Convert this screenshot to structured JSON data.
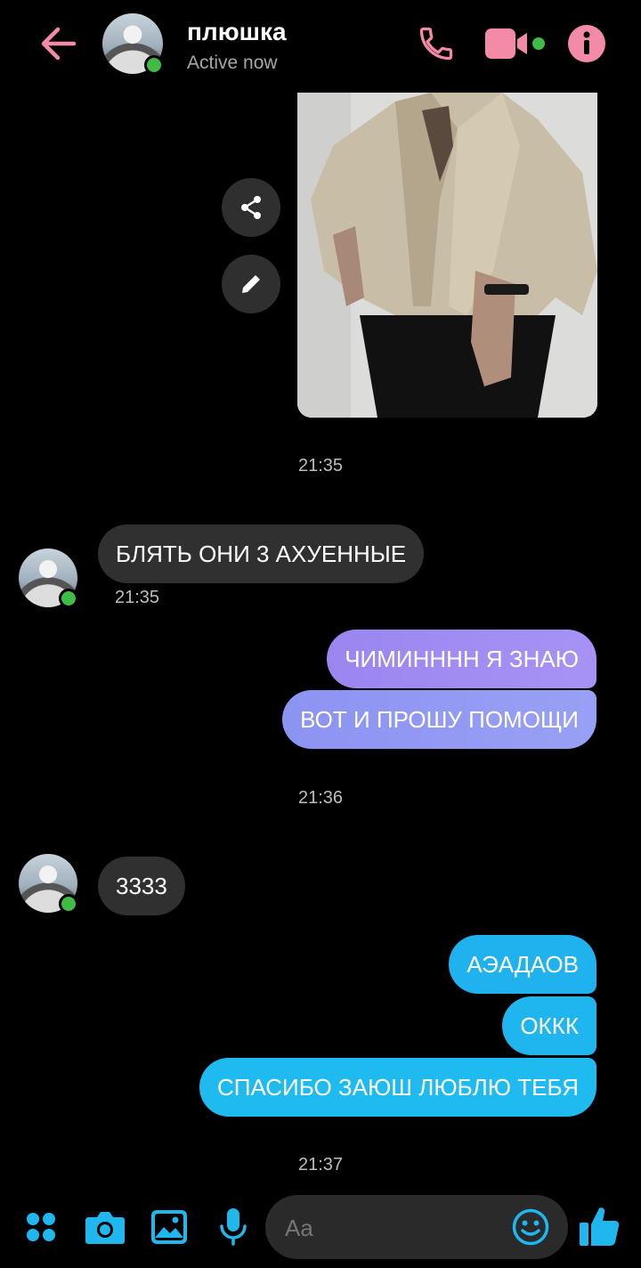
{
  "header": {
    "title": "плюшка",
    "status": "Active now"
  },
  "colors": {
    "accent_pink": "#f48ba6",
    "accent_blue": "#1fb7ee",
    "bubble_incoming": "#303030",
    "online_green": "#3fbb46"
  },
  "icons": [
    "back-arrow-icon",
    "phone-icon",
    "video-icon",
    "info-icon",
    "share-icon",
    "pencil-icon",
    "grid-icon",
    "camera-icon",
    "image-icon",
    "microphone-icon",
    "emoji-icon",
    "thumbs-up-icon"
  ],
  "messages": {
    "time_1": "21:35",
    "in_1": "БЛЯТЬ ОНИ 3 АХУЕННЫЕ",
    "in_1_time": "21:35",
    "out_1": "ЧИМИНННН Я ЗНАЮ",
    "out_2": "ВОТ И ПРОШУ ПОМОЩИ",
    "time_2": "21:36",
    "in_2": "3333",
    "out_3": "АЭАДАОВ",
    "out_4": "ОККК",
    "out_5": "СПАСИБО ЗАЮШ ЛЮБЛЮ ТЕБЯ",
    "time_3": "21:37"
  },
  "composer": {
    "placeholder": "Aa"
  }
}
